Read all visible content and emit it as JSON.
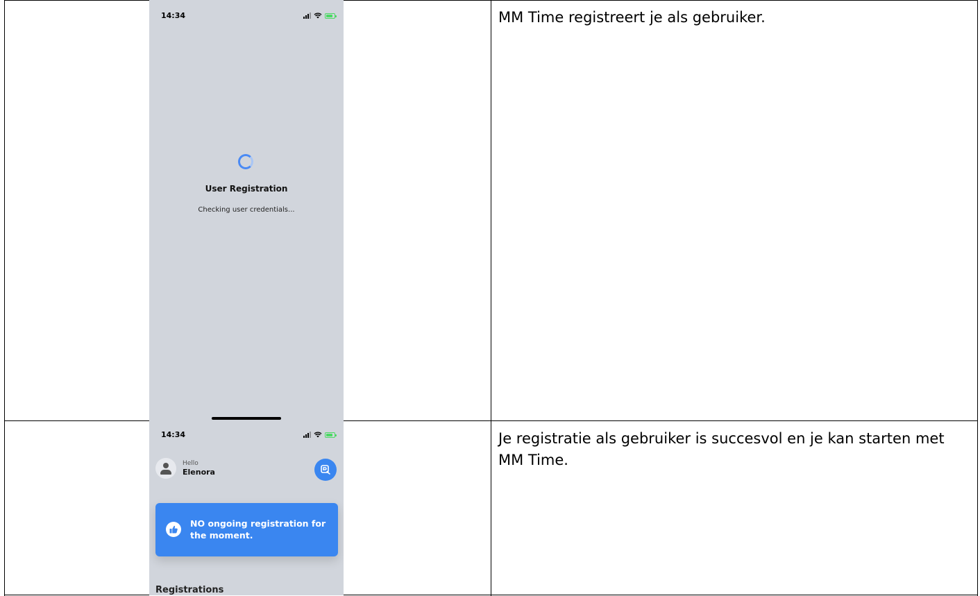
{
  "rows": [
    {
      "phone": {
        "status_time": "14:34",
        "title": "User Registration",
        "subtitle": "Checking user credentials..."
      },
      "description": "MM Time registreert je als gebruiker."
    },
    {
      "phone": {
        "status_time": "14:34",
        "greeting": "Hello",
        "username": "Elenora",
        "banner_text": "NO ongoing registration for the moment.",
        "section_title": "Registrations"
      },
      "description": "Je registratie als gebruiker is succesvol en je kan starten met MM Time."
    }
  ],
  "colors": {
    "accent": "#3a86f0",
    "phone_background": "#d1d5dc",
    "battery": "#4cd964"
  }
}
